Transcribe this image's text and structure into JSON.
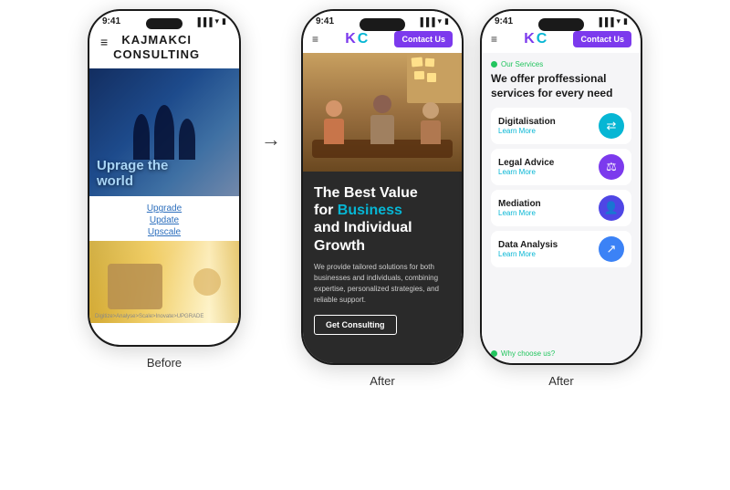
{
  "phones": {
    "before": {
      "label": "Before",
      "status_time": "9:41",
      "brand_line1": "KAJMAKCI",
      "brand_line2": "CONSULTING",
      "hero_text_part1": "Uprage the",
      "hero_text_part2": "world",
      "link1": "Upgrade",
      "link2": "Update",
      "link3": "Upscale",
      "footer_text": "Digitize>Analyse>Scale>Inovate>UPGRADE"
    },
    "after1": {
      "label": "After",
      "status_time": "9:41",
      "logo_k": "K",
      "logo_c": "C",
      "contact_btn": "Contact Us",
      "headline_part1": "The Best Value",
      "headline_part2": "for ",
      "headline_highlight": "Business",
      "headline_part3": "and Individual",
      "headline_part4": "Growth",
      "body_text": "We provide tailored solutions for both businesses and individuals, combining expertise, personalized strategies, and reliable support.",
      "cta_button": "Get Consulting"
    },
    "after2": {
      "label": "After",
      "status_time": "9:41",
      "logo_k": "K",
      "logo_c": "C",
      "contact_btn": "Contact Us",
      "our_services_label": "Our Services",
      "services_headline": "We offer proffessional services for every need",
      "services": [
        {
          "name": "Digitalisation",
          "learn": "Learn More",
          "icon": "⇄",
          "icon_class": "icon-teal"
        },
        {
          "name": "Legal Advice",
          "learn": "Learn More",
          "icon": "⚖",
          "icon_class": "icon-purple"
        },
        {
          "name": "Mediation",
          "learn": "Learn More",
          "icon": "👤",
          "icon_class": "icon-indigo"
        },
        {
          "name": "Data Analysis",
          "learn": "Learn More",
          "icon": "↗",
          "icon_class": "icon-blue"
        }
      ],
      "why_choose": "Why choose us?"
    }
  },
  "arrow": "→"
}
